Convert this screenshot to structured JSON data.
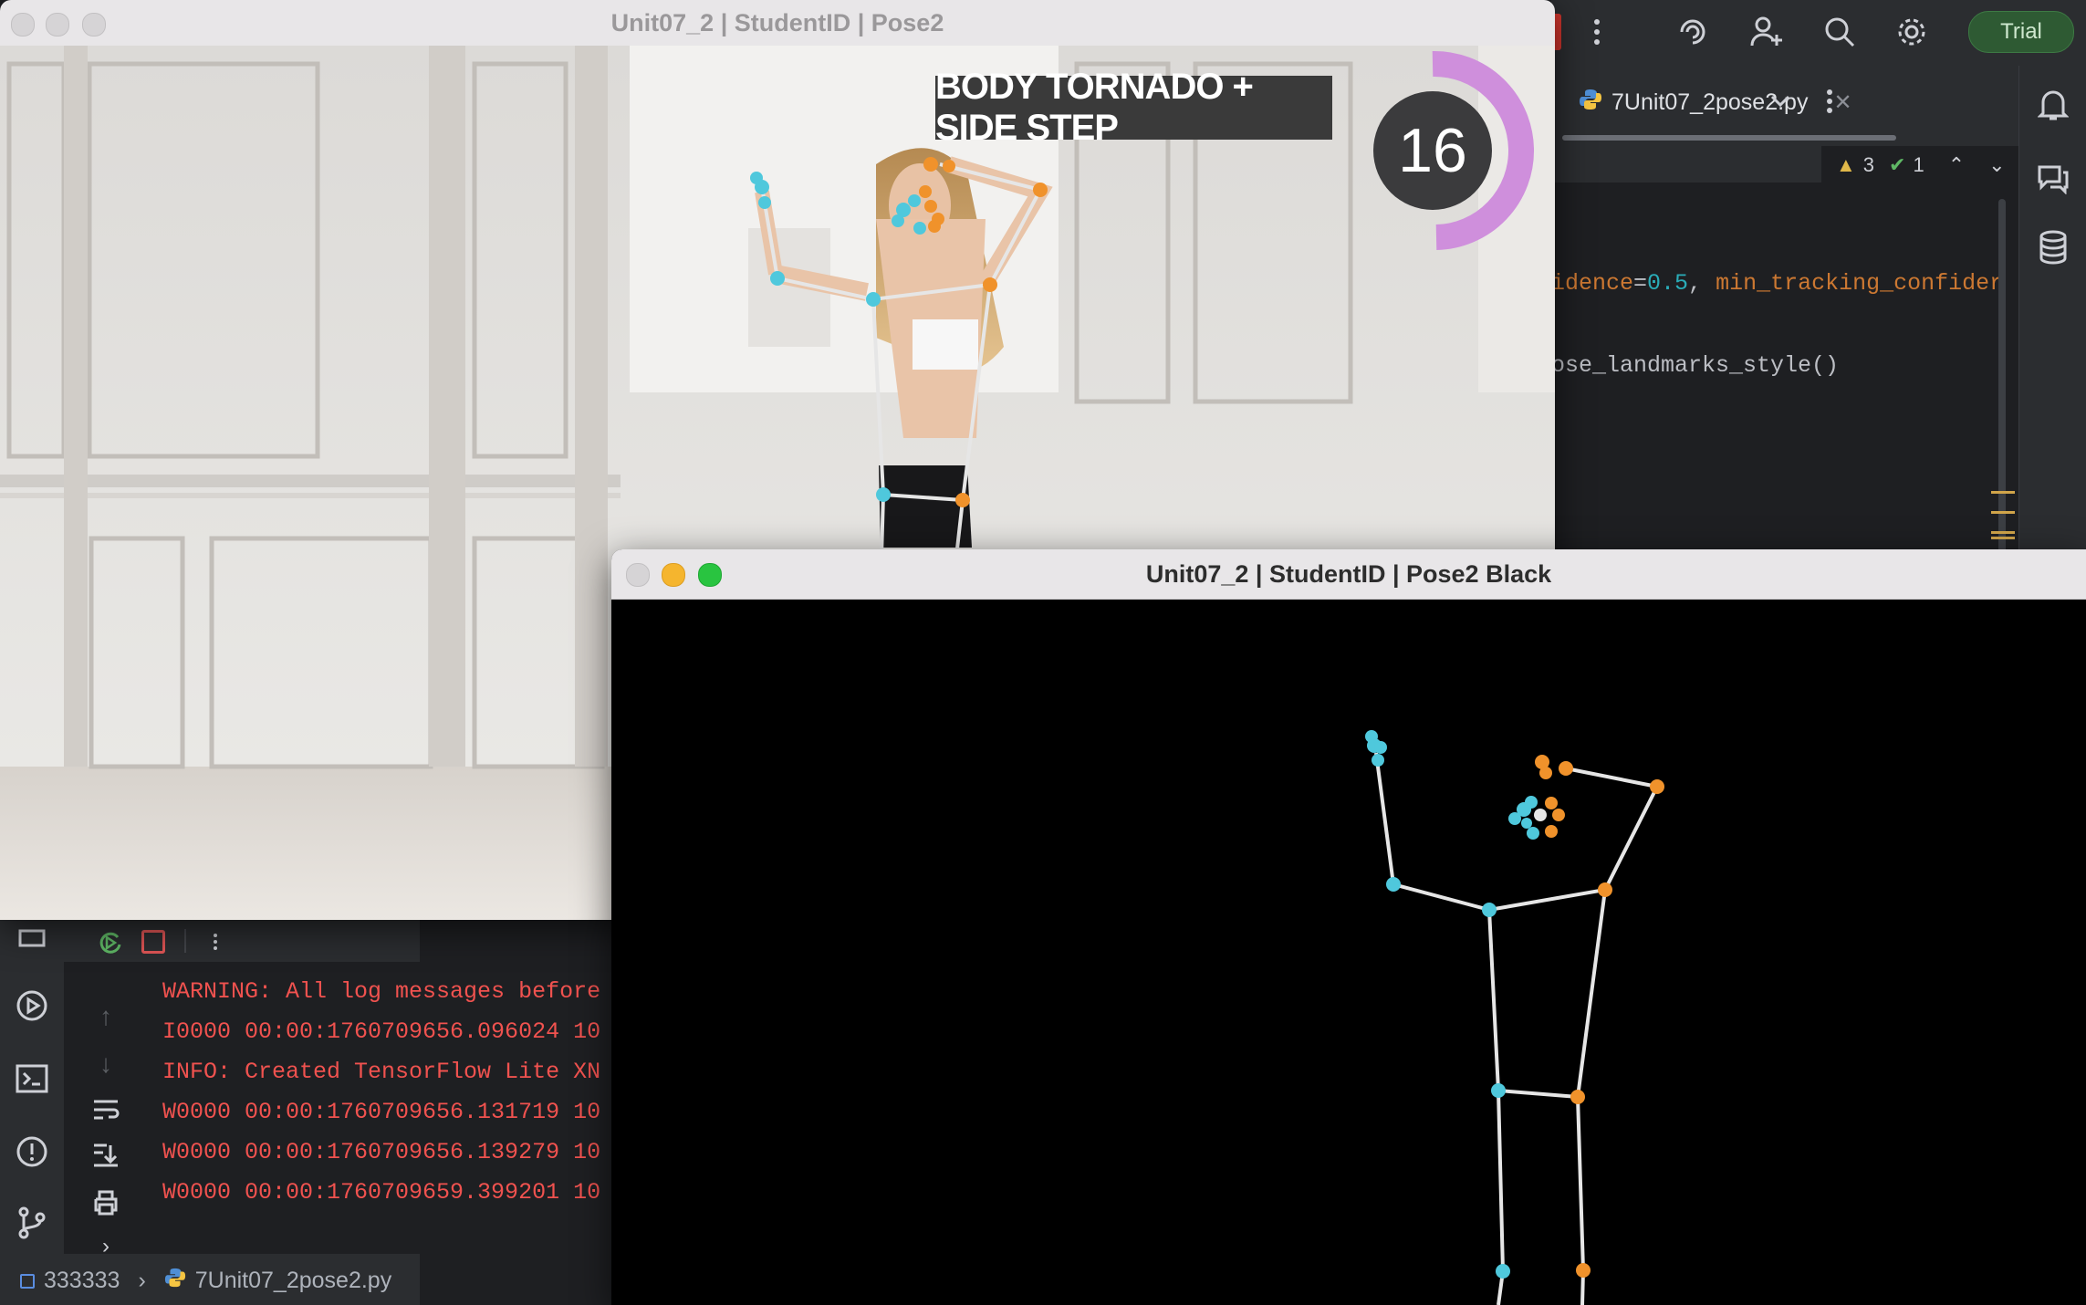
{
  "ide": {
    "trial_label": "Trial",
    "editor_tab": {
      "filename": "7Unit07_2pose2.py"
    },
    "inspections": {
      "warnings": "3",
      "passed": "1"
    },
    "code_lines": [
      {
        "parts": [
          {
            "t": "idence",
            "c": "param"
          },
          {
            "t": "=",
            "c": "plain"
          },
          {
            "t": "0.5",
            "c": "num"
          },
          {
            "t": ", ",
            "c": "plain"
          },
          {
            "t": "min_tracking_confider",
            "c": "param"
          }
        ]
      },
      {
        "parts": [
          {
            "t": "ose_landmarks_style()",
            "c": "plain"
          }
        ]
      }
    ],
    "run_log": [
      "WARNING: All log messages before",
      "I0000 00:00:1760709656.096024 10",
      "INFO: Created TensorFlow Lite XN",
      "W0000 00:00:1760709656.131719 10",
      "W0000 00:00:1760709656.139279 10",
      "W0000 00:00:1760709659.399201 10"
    ],
    "status_bar": {
      "project": "333333",
      "file": "7Unit07_2pose2.py"
    }
  },
  "window_video": {
    "title": "Unit07_2 | StudentID | Pose2",
    "banner": "BODY TORNADO + SIDE STEP",
    "counter": "16",
    "counter_progress": 0.5
  },
  "window_black": {
    "title": "Unit07_2 | StudentID | Pose2 Black"
  },
  "colors": {
    "left_landmark": "#4fc8dc",
    "right_landmark": "#f0922b",
    "connection": "#e6e6e6",
    "trial_bg": "#2e5a33",
    "log_text": "#f0524f"
  },
  "icons": {
    "topbar": [
      "more-vertical-icon",
      "ai-assistant-icon",
      "add-user-icon",
      "search-icon",
      "settings-gear-icon"
    ],
    "right_rail": [
      "notifications-bell-icon",
      "ai-chat-icon",
      "database-icon"
    ],
    "tool_window": [
      "python-console-icon",
      "run-icon",
      "terminal-icon",
      "problems-icon",
      "git-icon"
    ]
  }
}
